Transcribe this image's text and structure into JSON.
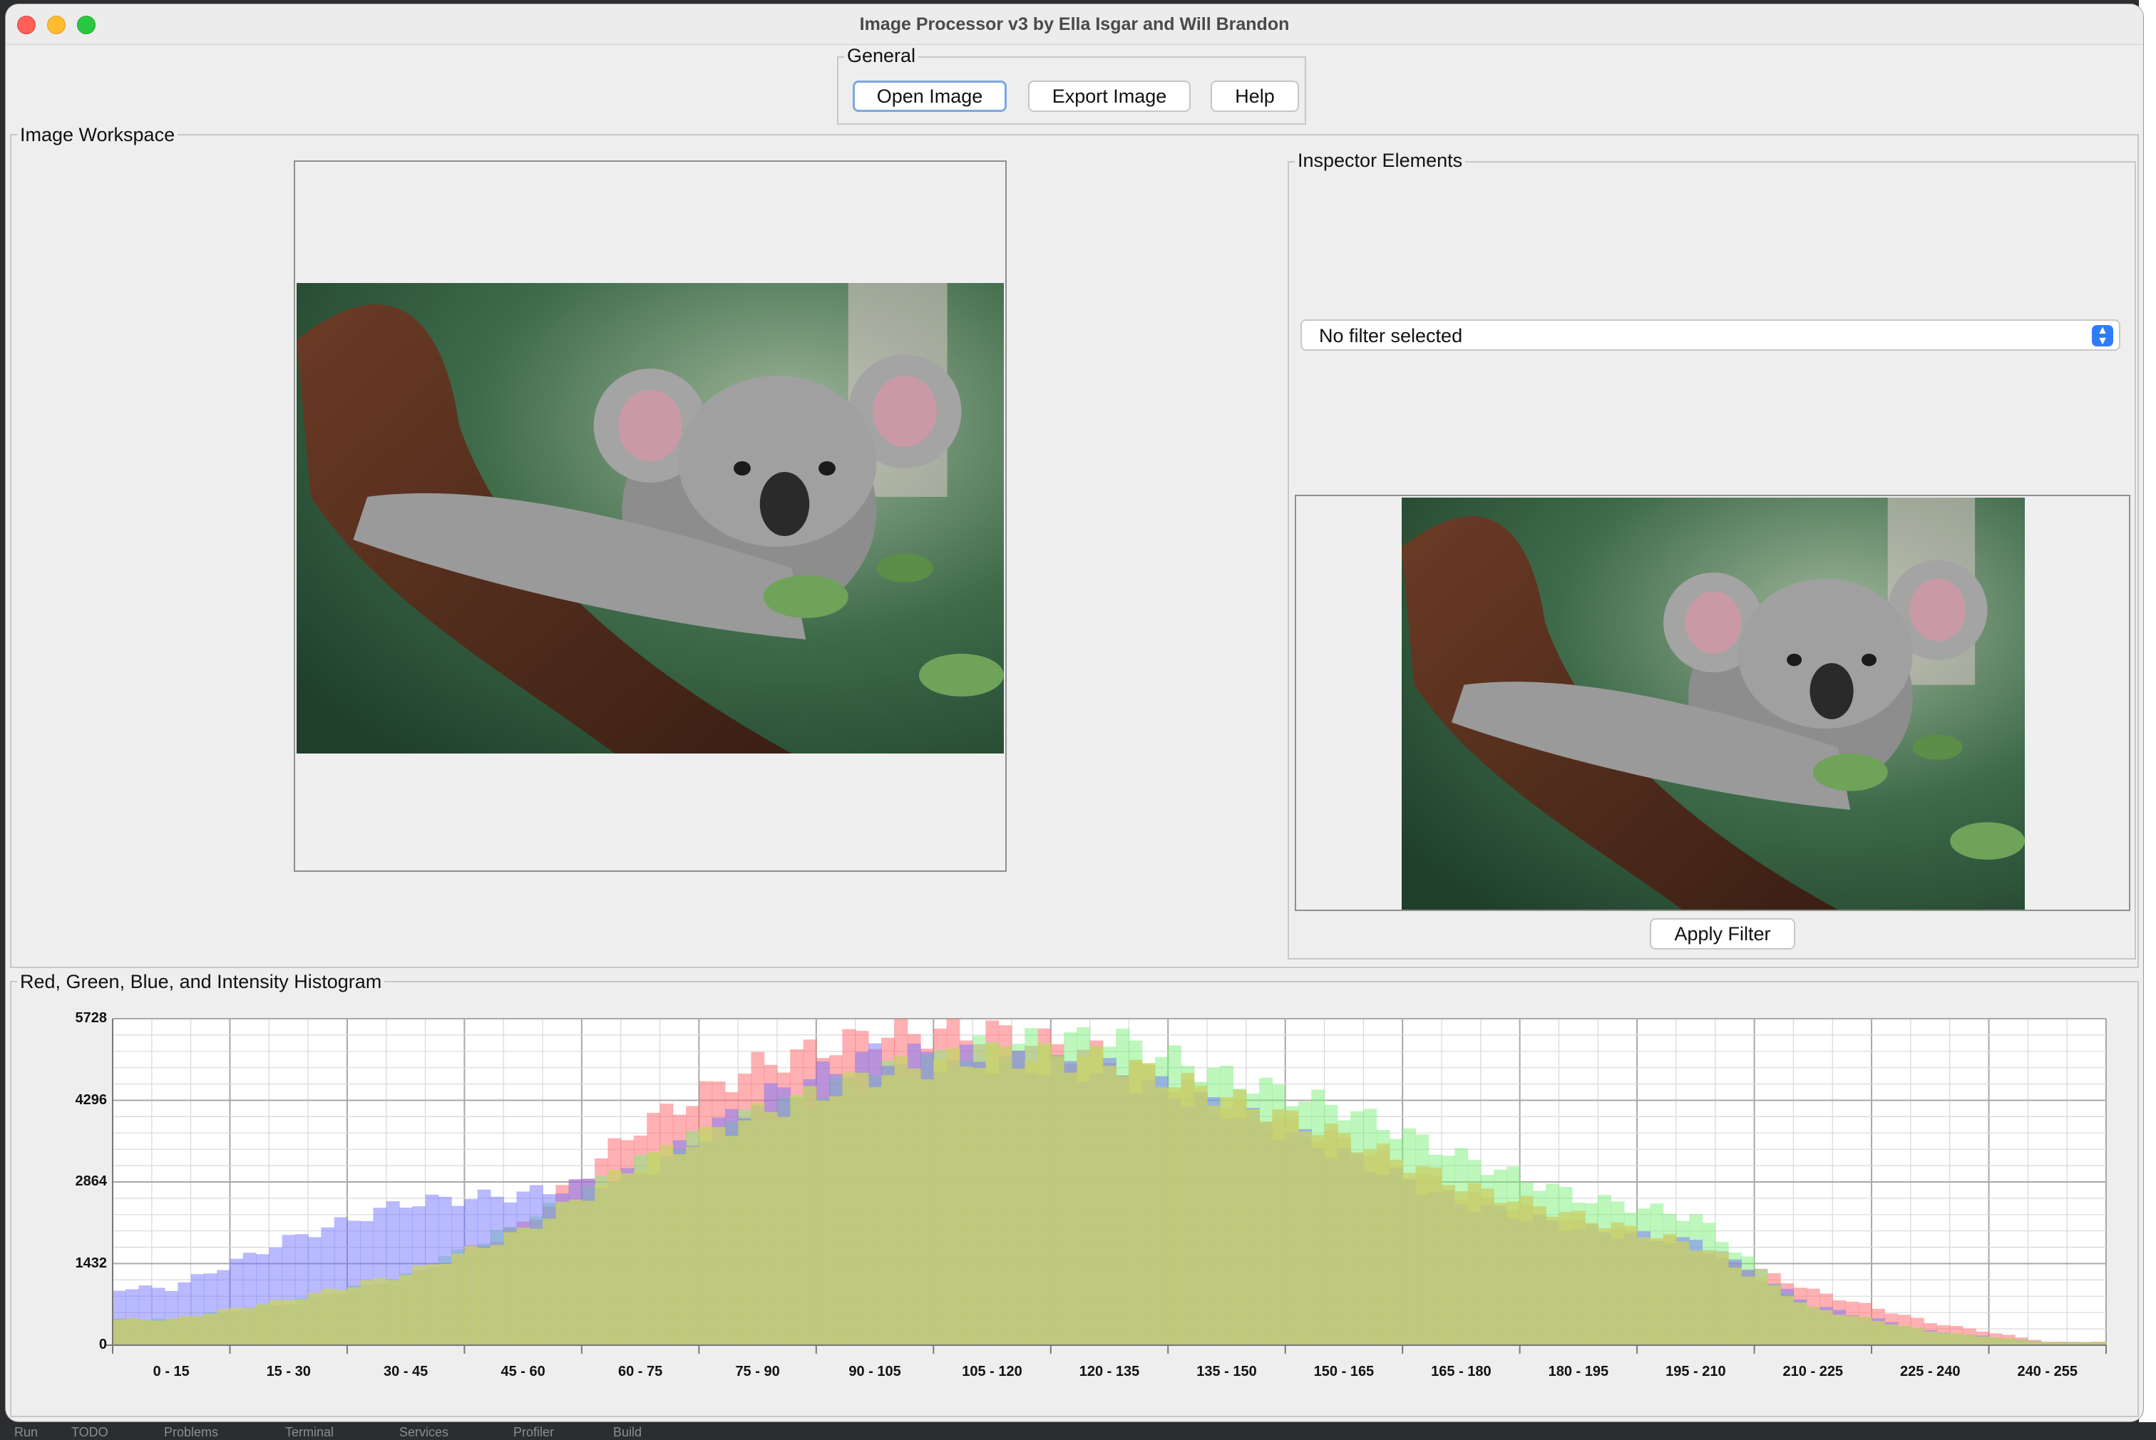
{
  "window": {
    "title": "Image Processor v3 by Ella Isgar and Will Brandon"
  },
  "general": {
    "legend": "General",
    "buttons": {
      "open": "Open Image",
      "export": "Export Image",
      "help": "Help"
    }
  },
  "workspace": {
    "legend": "Image Workspace"
  },
  "inspector": {
    "legend": "Inspector Elements",
    "filter_select": {
      "value": "No filter selected"
    },
    "apply_label": "Apply Filter"
  },
  "histogram": {
    "legend": "Red, Green, Blue, and Intensity Histogram"
  },
  "ide_toolbar": {
    "items": [
      "Run",
      "TODO",
      "Problems",
      "Terminal",
      "Services",
      "Profiler",
      "Build"
    ]
  },
  "colors": {
    "red": "#ff6f73",
    "green": "#7cf07a",
    "blue": "#7373ff",
    "intensity": "#c8d26a",
    "accent": "#2f7df6"
  },
  "chart_data": {
    "type": "bar",
    "title": "Red, Green, Blue, and Intensity Histogram",
    "xlabel": "",
    "ylabel": "",
    "ylim": [
      0,
      5728
    ],
    "yticks": [
      0,
      1432,
      2864,
      4296,
      5728
    ],
    "categories": [
      "0 - 15",
      "15 - 30",
      "30 - 45",
      "45 - 60",
      "60 - 75",
      "75 - 90",
      "90 - 105",
      "105 - 120",
      "120 - 135",
      "135 - 150",
      "150 - 165",
      "165 - 180",
      "180 - 195",
      "195 - 210",
      "210 - 225",
      "225 - 240",
      "240 - 255"
    ],
    "grid": true,
    "series": [
      {
        "name": "Red",
        "values": [
          450,
          700,
          1150,
          2100,
          3850,
          4900,
          5450,
          5500,
          5050,
          4150,
          3550,
          2650,
          2100,
          1750,
          950,
          400,
          60
        ]
      },
      {
        "name": "Green",
        "values": [
          450,
          750,
          1200,
          2150,
          3200,
          4050,
          4700,
          5250,
          5400,
          4700,
          4150,
          3300,
          2600,
          2250,
          550,
          200,
          50
        ]
      },
      {
        "name": "Blue",
        "values": [
          1000,
          1850,
          2500,
          2650,
          3000,
          4300,
          5100,
          5000,
          4800,
          4150,
          3350,
          2500,
          2050,
          1800,
          700,
          250,
          50
        ]
      },
      {
        "name": "Intensity",
        "values": [
          450,
          800,
          1250,
          2000,
          3200,
          4050,
          4750,
          5100,
          5000,
          4350,
          3650,
          2800,
          2250,
          1750,
          650,
          250,
          50
        ]
      }
    ]
  }
}
